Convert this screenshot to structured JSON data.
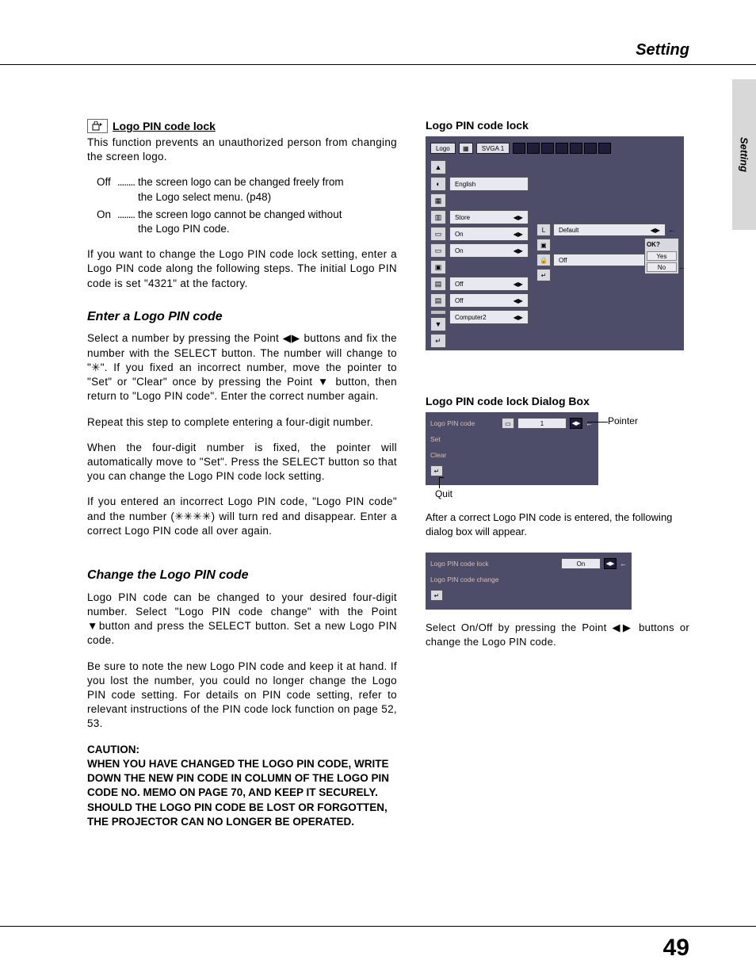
{
  "header": {
    "title": "Setting"
  },
  "sideTab": {
    "label": "Setting"
  },
  "left": {
    "lockTitle": "Logo PIN code lock",
    "lockIcon": "lock-icon",
    "intro": "This function prevents an unauthorized person from changing the screen logo.",
    "options": {
      "off": {
        "key": "Off",
        "desc1": "the screen logo can be changed freely from",
        "desc2": "the Logo select menu.  (p48)"
      },
      "on": {
        "key": "On",
        "desc1": "the screen logo cannot be changed without",
        "desc2": "the Logo PIN code."
      }
    },
    "afterOptions": "If you want to change the Logo PIN code lock setting, enter a Logo PIN code along the following steps. The initial Logo PIN code is set \"4321\" at the factory.",
    "h2a": "Enter a Logo PIN code",
    "p1a": "Select a number by pressing the Point ◀▶ buttons and fix the number with the SELECT button.  The number will change to \"✳\".  If you fixed an incorrect number, move the pointer to \"Set\" or \"Clear\" once by pressing the Point ▼ button, then return to \"Logo PIN code\".  Enter the correct number again.",
    "p1b": "Repeat this step to complete entering a four-digit number.",
    "p1c": "When the four-digit number is fixed, the pointer will automatically move to \"Set\".  Press the SELECT button so that you can change the Logo PIN code lock setting.",
    "p1d": "If you entered an incorrect Logo PIN code, \"Logo PIN code\" and the number (✳✳✳✳) will turn red and disappear.  Enter a correct Logo PIN code all over again.",
    "h2b": "Change the Logo PIN code",
    "p2a": "Logo PIN code can be changed to your desired four-digit number. Select \"Logo PIN code change\" with the Point ▼button and press the SELECT button. Set a new Logo PIN code.",
    "p2b": "Be sure to note the new Logo PIN code and keep it at hand.  If you lost the number, you could no longer change the Logo PIN code setting.  For details on PIN code setting, refer to relevant instructions of the PIN code lock function on page 52, 53.",
    "cautionLabel": "CAUTION:",
    "caution": "WHEN YOU HAVE CHANGED THE LOGO PIN CODE, WRITE DOWN THE NEW PIN CODE IN COLUMN OF THE LOGO PIN CODE NO. MEMO ON PAGE 70, AND KEEP IT SECURELY.  SHOULD THE LOGO PIN CODE BE LOST OR FORGOTTEN, THE PROJECTOR CAN NO LONGER BE OPERATED."
  },
  "right": {
    "fig1Title": "Logo PIN code lock",
    "osd": {
      "topLabel": "Logo",
      "mode": "SVGA 1",
      "rows": [
        "English",
        "",
        "Store",
        "On",
        "On",
        "",
        "Off",
        "Off",
        "Computer2"
      ],
      "sub": {
        "default": "Default",
        "off": "Off"
      },
      "confirm": {
        "q": "OK?",
        "yes": "Yes",
        "no": "No"
      }
    },
    "fig2Title": "Logo PIN code lock Dialog Box",
    "dlg": {
      "label": "Logo PIN code",
      "set": "Set",
      "clear": "Clear",
      "value": "1",
      "pointer": "Pointer",
      "quit": "Quit"
    },
    "note": "After a correct Logo PIN code is entered, the following dialog box will appear.",
    "dlg2": {
      "row1": "Logo PIN code lock",
      "row1val": "On",
      "row2": "Logo PIN code change"
    },
    "instr": "Select On/Off by pressing the Point ◀▶ buttons or change the Logo PIN code."
  },
  "pageNumber": "49"
}
